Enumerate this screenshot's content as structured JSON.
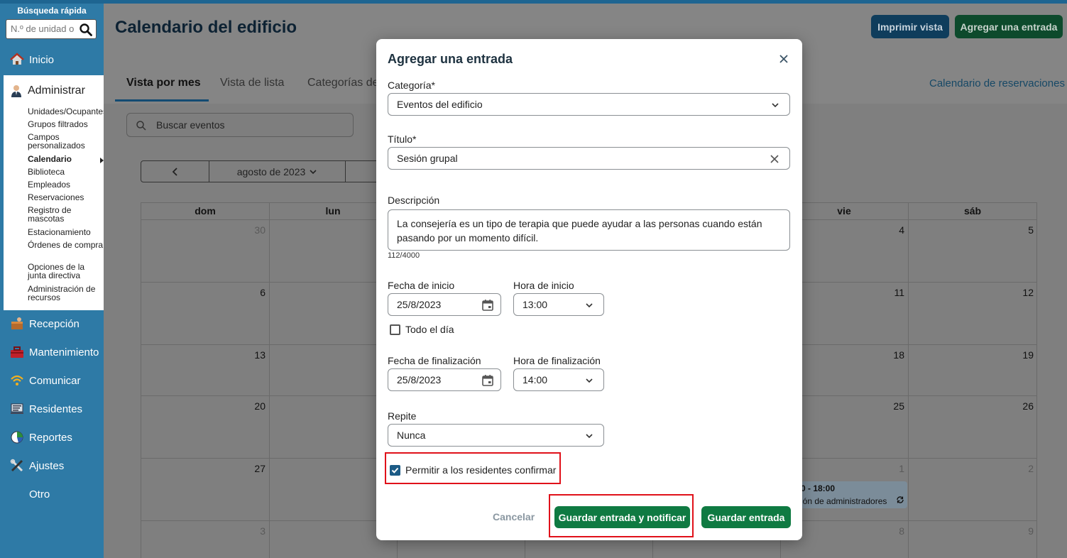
{
  "sidebar": {
    "quick_search_title": "Búsqueda rápida",
    "quick_search_placeholder": "N.º de unidad o",
    "items": [
      {
        "label": "Inicio"
      },
      {
        "label": "Administrar"
      },
      {
        "label": "Recepción"
      },
      {
        "label": "Mantenimiento"
      },
      {
        "label": "Comunicar"
      },
      {
        "label": "Residentes"
      },
      {
        "label": "Reportes"
      },
      {
        "label": "Ajustes"
      },
      {
        "label": "Otro"
      }
    ],
    "admin_subitems": [
      {
        "label": "Unidades/Ocupantes"
      },
      {
        "label": "Grupos filtrados"
      },
      {
        "label": "Campos personalizados"
      },
      {
        "label": "Calendario"
      },
      {
        "label": "Biblioteca"
      },
      {
        "label": "Empleados"
      },
      {
        "label": "Reservaciones"
      },
      {
        "label": "Registro de mascotas"
      },
      {
        "label": "Estacionamiento"
      },
      {
        "label": "Órdenes de compra"
      },
      {
        "label": "Opciones de la junta directiva"
      },
      {
        "label": "Administración de recursos"
      }
    ]
  },
  "header": {
    "title": "Calendario del edificio",
    "print_button": "Imprimir vista",
    "add_button": "Agregar una entrada"
  },
  "tabs": [
    {
      "label": "Vista por mes"
    },
    {
      "label": "Vista de lista"
    },
    {
      "label": "Categorías de"
    }
  ],
  "reservations_link": "Calendario de reservaciones",
  "search_events_placeholder": "Buscar eventos",
  "calendar": {
    "month_label": "agosto de 2023",
    "day_headers": [
      "dom",
      "lun",
      "vie",
      "sáb"
    ],
    "day_numbers": {
      "sun": [
        "30",
        "6",
        "13",
        "20",
        "27",
        "3"
      ],
      "fri": [
        "4",
        "11",
        "18",
        "25",
        "1",
        "8"
      ],
      "sat": [
        "5",
        "12",
        "19",
        "26",
        "2",
        "9"
      ]
    },
    "event": {
      "time": "0 - 18:00",
      "title": "ión de administradores"
    }
  },
  "modal": {
    "title": "Agregar una entrada",
    "category_label": "Categoría*",
    "category_value": "Eventos del edificio",
    "title_label": "Título*",
    "title_value": "Sesión grupal",
    "description_label": "Descripción",
    "description_value": "La consejería es un tipo de terapia que puede ayudar a las personas cuando están pasando por un momento difícil.",
    "char_counter": "112/4000",
    "start_date_label": "Fecha de inicio",
    "start_date_value": "25/8/2023",
    "start_time_label": "Hora de inicio",
    "start_time_value": "13:00",
    "all_day_label": "Todo el día",
    "end_date_label": "Fecha de finalización",
    "end_date_value": "25/8/2023",
    "end_time_label": "Hora de finalización",
    "end_time_value": "14:00",
    "repeat_label": "Repite",
    "repeat_value": "Nunca",
    "allow_rsvp_label": "Permitir a los residentes confirmar",
    "allow_rsvp_checked": true,
    "all_day_checked": false,
    "cancel_button": "Cancelar",
    "save_notify_button": "Guardar entrada y notificar",
    "save_button": "Guardar entrada"
  },
  "colors": {
    "sidebar_bg": "#2e7aa6",
    "primary_green": "#0f7a42",
    "highlight_red": "#e0111a",
    "checkbox_blue": "#1c5b86"
  }
}
